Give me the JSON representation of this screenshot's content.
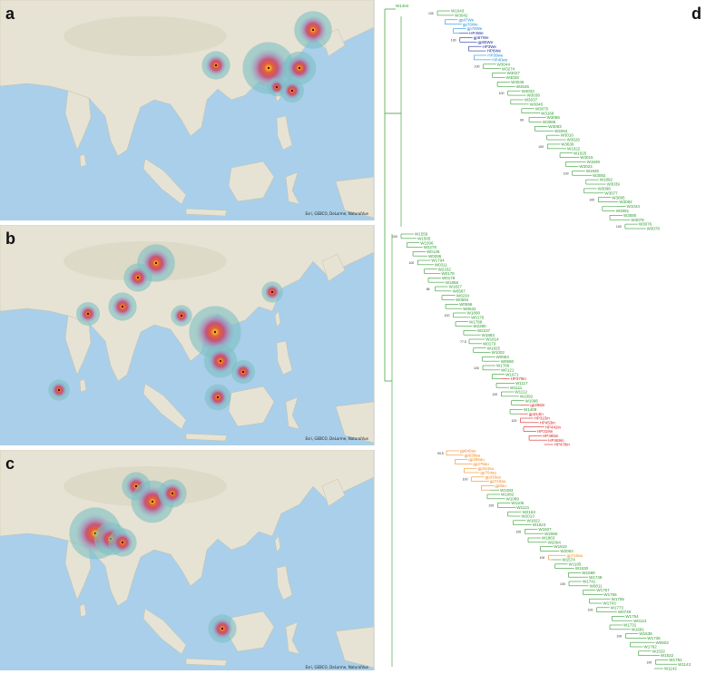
{
  "panels": {
    "a": {
      "label": "a",
      "attribution": "Esri, GEBCO, DeLorme, NaturalVue"
    },
    "b": {
      "label": "b",
      "attribution": "Esri, GEBCO, DeLorme, NaturalVue"
    },
    "c": {
      "label": "c",
      "attribution": "Esri, GEBCO, DeLorme, NaturalVue"
    },
    "d": {
      "label": "d"
    }
  },
  "colors": {
    "ocean": "#a9cfea",
    "land": "#e7e3d4",
    "green_clade": "#2e9a2e",
    "blue_clade": "#1f8fe0",
    "navy_clade": "#1a2b9b",
    "red_clade": "#d81f1f",
    "orange_clade": "#f08a24",
    "heat_halo": "#7fbfc3",
    "heat_mid": "#c9416c",
    "heat_core": "#f5e23a"
  },
  "tree": {
    "root_label": "W1404",
    "clade1_tips": [
      {
        "text": "W1043",
        "c": "g"
      },
      {
        "text": "W3042",
        "c": "g"
      },
      {
        "text": "gp47We",
        "c": "b"
      },
      {
        "text": "gp76We",
        "c": "b"
      },
      {
        "text": "gp78We",
        "c": "b"
      },
      {
        "text": "HP4We",
        "c": "n"
      },
      {
        "text": "gp67We",
        "c": "n"
      },
      {
        "text": "gp65We",
        "c": "n"
      },
      {
        "text": "HP3We",
        "c": "n"
      },
      {
        "text": "HP6We",
        "c": "n"
      },
      {
        "text": "HP39we",
        "c": "b"
      },
      {
        "text": "HP40we",
        "c": "b"
      },
      {
        "text": "W3044",
        "c": "g"
      },
      {
        "text": "W3274",
        "c": "g"
      },
      {
        "text": "W3027",
        "c": "g"
      },
      {
        "text": "W3028",
        "c": "g"
      },
      {
        "text": "W3046",
        "c": "g"
      },
      {
        "text": "W3045",
        "c": "g"
      },
      {
        "text": "W3032",
        "c": "g"
      },
      {
        "text": "W3038",
        "c": "g"
      },
      {
        "text": "W3037",
        "c": "g"
      },
      {
        "text": "W3048",
        "c": "g"
      },
      {
        "text": "W3075",
        "c": "g"
      },
      {
        "text": "W3168",
        "c": "g"
      },
      {
        "text": "W3086",
        "c": "g"
      },
      {
        "text": "W3085",
        "c": "g"
      },
      {
        "text": "W3093",
        "c": "g"
      },
      {
        "text": "W3094",
        "c": "g"
      },
      {
        "text": "W3010",
        "c": "g"
      },
      {
        "text": "W3626",
        "c": "g"
      },
      {
        "text": "W3636",
        "c": "g"
      },
      {
        "text": "W1022",
        "c": "g"
      },
      {
        "text": "W1025",
        "c": "g"
      },
      {
        "text": "W3015",
        "c": "g"
      },
      {
        "text": "W1849",
        "c": "g"
      },
      {
        "text": "W3023",
        "c": "g"
      },
      {
        "text": "W1845",
        "c": "g"
      },
      {
        "text": "W3092",
        "c": "g"
      },
      {
        "text": "W1892",
        "c": "g"
      },
      {
        "text": "W3039",
        "c": "g"
      },
      {
        "text": "W3096",
        "c": "g"
      },
      {
        "text": "W3077",
        "c": "g"
      },
      {
        "text": "W3095",
        "c": "g"
      },
      {
        "text": "W3082",
        "c": "g"
      },
      {
        "text": "W1043",
        "c": "g"
      },
      {
        "text": "W3081",
        "c": "g"
      },
      {
        "text": "W3080",
        "c": "g"
      },
      {
        "text": "W3079",
        "c": "g"
      },
      {
        "text": "W3076",
        "c": "g"
      },
      {
        "text": "W3078",
        "c": "g"
      }
    ],
    "clade2_tips": [
      {
        "text": "W1559",
        "c": "g"
      },
      {
        "text": "W1505",
        "c": "g"
      },
      {
        "text": "W1506",
        "c": "g"
      },
      {
        "text": "W2278",
        "c": "g"
      },
      {
        "text": "W0128",
        "c": "g"
      },
      {
        "text": "W0295",
        "c": "g"
      },
      {
        "text": "W1794",
        "c": "g"
      },
      {
        "text": "W0311",
        "c": "g"
      },
      {
        "text": "W2332",
        "c": "g"
      },
      {
        "text": "W0178",
        "c": "g"
      },
      {
        "text": "W0179",
        "c": "g"
      },
      {
        "text": "W1858",
        "c": "g"
      },
      {
        "text": "W1827",
        "c": "g"
      },
      {
        "text": "W0587",
        "c": "g"
      },
      {
        "text": "W0234",
        "c": "g"
      },
      {
        "text": "W0594",
        "c": "g"
      },
      {
        "text": "W0596",
        "c": "g"
      },
      {
        "text": "W0632",
        "c": "g"
      },
      {
        "text": "W1808",
        "c": "g"
      },
      {
        "text": "W0176",
        "c": "g"
      },
      {
        "text": "W1788",
        "c": "g"
      },
      {
        "text": "W2280",
        "c": "g"
      },
      {
        "text": "W2237",
        "c": "g"
      },
      {
        "text": "W1883",
        "c": "g"
      },
      {
        "text": "W1814",
        "c": "g"
      },
      {
        "text": "W0173",
        "c": "g"
      },
      {
        "text": "W1825",
        "c": "g"
      },
      {
        "text": "W1002",
        "c": "g"
      },
      {
        "text": "W0063",
        "c": "g"
      },
      {
        "text": "W0590",
        "c": "g"
      },
      {
        "text": "W1786",
        "c": "g"
      },
      {
        "text": "W0121",
        "c": "g"
      },
      {
        "text": "W1671",
        "c": "g"
      },
      {
        "text": "HP379in",
        "c": "r"
      },
      {
        "text": "W1117",
        "c": "g"
      },
      {
        "text": "W1111",
        "c": "g"
      },
      {
        "text": "W1112",
        "c": "g"
      },
      {
        "text": "W1092",
        "c": "g"
      },
      {
        "text": "W1096",
        "c": "g"
      },
      {
        "text": "gp296in",
        "c": "r"
      },
      {
        "text": "W1409",
        "c": "g"
      },
      {
        "text": "gp314in",
        "c": "r"
      },
      {
        "text": "HP315in",
        "c": "r"
      },
      {
        "text": "HP453in",
        "c": "r"
      },
      {
        "text": "HP442in",
        "c": "r"
      },
      {
        "text": "HP319in",
        "c": "r"
      },
      {
        "text": "HP485in",
        "c": "r"
      },
      {
        "text": "HP469in",
        "c": "r"
      },
      {
        "text": "HP478in",
        "c": "r"
      }
    ],
    "clade3_tips": [
      {
        "text": "gp640au",
        "c": "o"
      },
      {
        "text": "gp638au",
        "c": "o"
      },
      {
        "text": "gp285au",
        "c": "o"
      },
      {
        "text": "gp275au",
        "c": "o"
      },
      {
        "text": "gp154au",
        "c": "o"
      },
      {
        "text": "gp764au",
        "c": "o"
      },
      {
        "text": "gp330au",
        "c": "o"
      },
      {
        "text": "gp719au",
        "c": "o"
      },
      {
        "text": "gp8au",
        "c": "o"
      },
      {
        "text": "W1083",
        "c": "g"
      },
      {
        "text": "W1082",
        "c": "g"
      },
      {
        "text": "W1089",
        "c": "g"
      },
      {
        "text": "W1105",
        "c": "g"
      },
      {
        "text": "W1121",
        "c": "g"
      },
      {
        "text": "W2163",
        "c": "g"
      },
      {
        "text": "W2013",
        "c": "g"
      },
      {
        "text": "W1822",
        "c": "g"
      },
      {
        "text": "W1823",
        "c": "g"
      },
      {
        "text": "W1827",
        "c": "g"
      },
      {
        "text": "W2060",
        "c": "g"
      },
      {
        "text": "W1863",
        "c": "g"
      },
      {
        "text": "W2064",
        "c": "g"
      },
      {
        "text": "W1819",
        "c": "g"
      },
      {
        "text": "W2063",
        "c": "g"
      },
      {
        "text": "gp715au",
        "c": "o"
      },
      {
        "text": "W1574",
        "c": "g"
      },
      {
        "text": "W1105",
        "c": "g"
      },
      {
        "text": "W1530",
        "c": "g"
      },
      {
        "text": "W1589",
        "c": "g"
      },
      {
        "text": "W1748",
        "c": "g"
      },
      {
        "text": "W1741",
        "c": "g"
      },
      {
        "text": "W0811",
        "c": "g"
      },
      {
        "text": "W1757",
        "c": "g"
      },
      {
        "text": "W1756",
        "c": "g"
      },
      {
        "text": "W1755",
        "c": "g"
      },
      {
        "text": "W1743",
        "c": "g"
      },
      {
        "text": "W1773",
        "c": "g"
      },
      {
        "text": "W0749",
        "c": "g"
      },
      {
        "text": "W1754",
        "c": "g"
      },
      {
        "text": "W0124",
        "c": "g"
      },
      {
        "text": "W1731",
        "c": "g"
      },
      {
        "text": "W1681",
        "c": "g"
      },
      {
        "text": "W1638",
        "c": "g"
      },
      {
        "text": "W1736",
        "c": "g"
      },
      {
        "text": "W0602",
        "c": "g"
      },
      {
        "text": "W1762",
        "c": "g"
      },
      {
        "text": "W1532",
        "c": "g"
      },
      {
        "text": "W1522",
        "c": "g"
      },
      {
        "text": "W1782",
        "c": "g"
      },
      {
        "text": "W1143",
        "c": "g"
      },
      {
        "text": "W1142",
        "c": "g"
      }
    ],
    "bootstrap": [
      "100",
      "100",
      "100",
      "100",
      "99",
      "100",
      "100",
      "100",
      "100",
      "100",
      "100",
      "98",
      "100",
      "77.5",
      "100",
      "100",
      "100",
      "99.5",
      "100",
      "100",
      "100",
      "100",
      "100",
      "100",
      "100",
      "100",
      "97",
      "78.4",
      "100",
      "99.1",
      "91.3",
      "96.3",
      "100",
      "100"
    ]
  }
}
